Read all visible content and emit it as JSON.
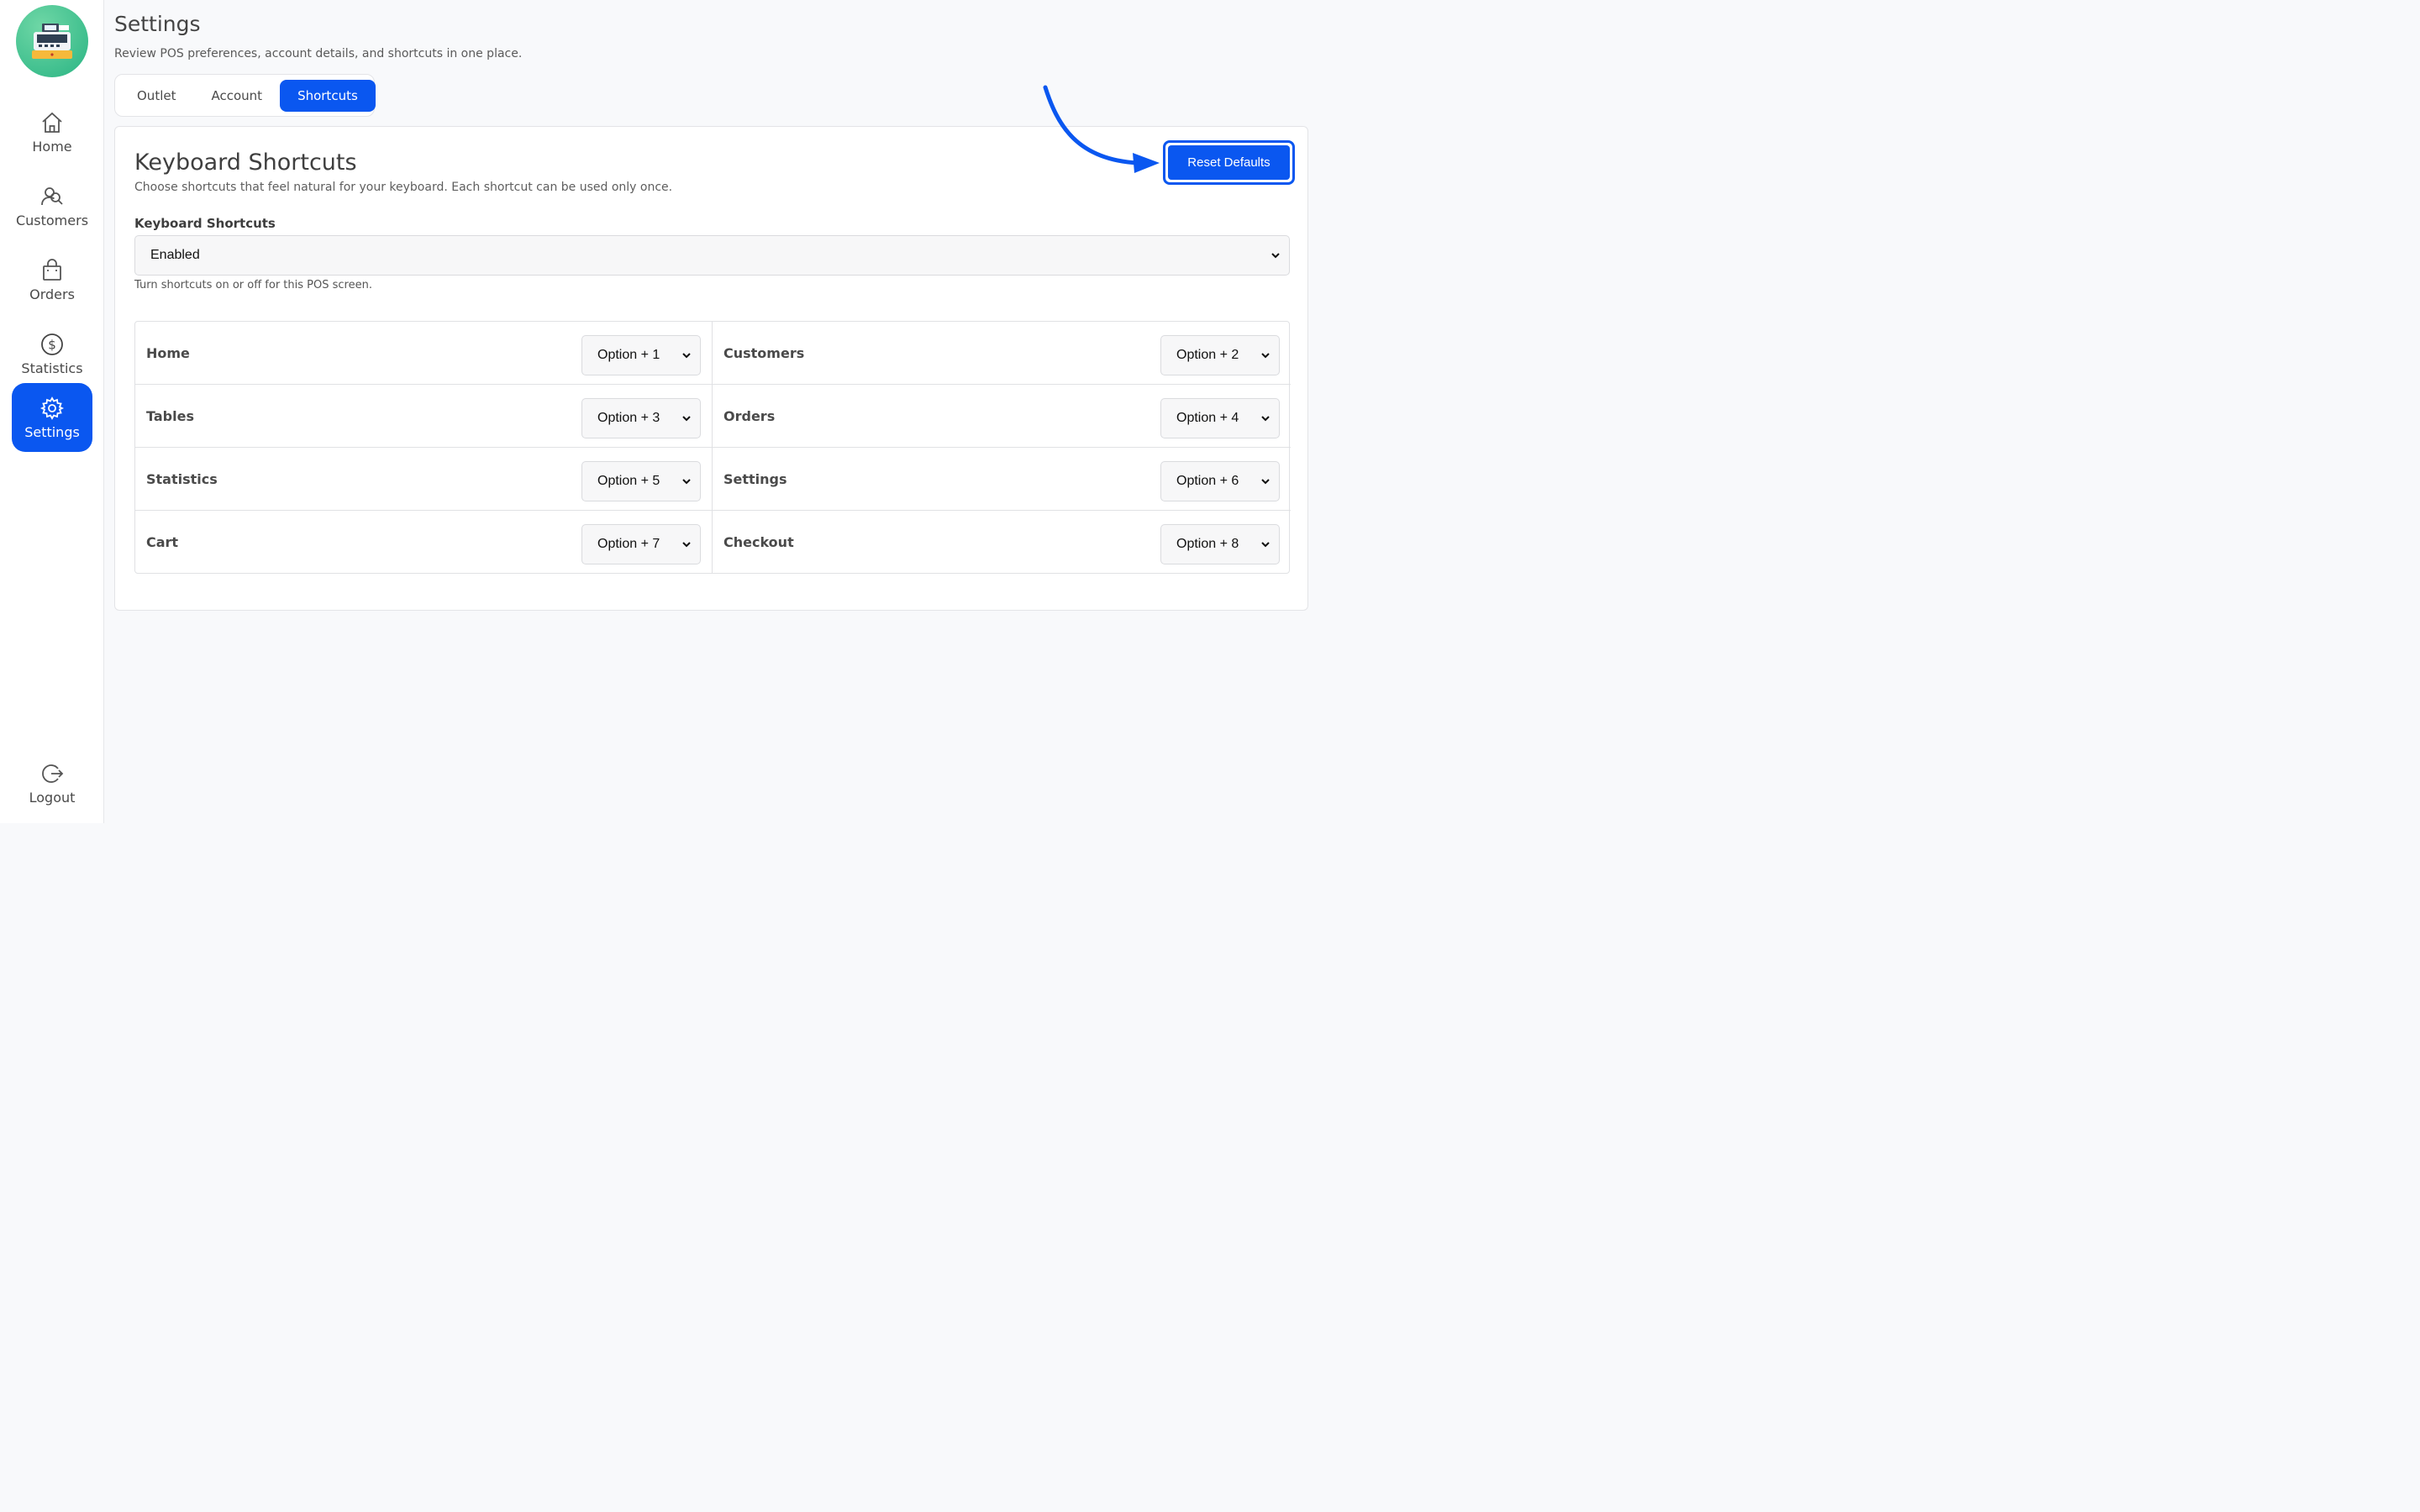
{
  "sidebar": {
    "items": [
      {
        "label": "Home",
        "icon": "home-icon"
      },
      {
        "label": "Customers",
        "icon": "customers-icon"
      },
      {
        "label": "Orders",
        "icon": "bag-icon"
      },
      {
        "label": "Statistics",
        "icon": "dollar-icon"
      },
      {
        "label": "Settings",
        "icon": "gear-icon",
        "active": true
      }
    ],
    "logout_label": "Logout"
  },
  "header": {
    "title": "Settings",
    "subtitle": "Review POS preferences, account details, and shortcuts in one place."
  },
  "tabs": [
    {
      "label": "Outlet"
    },
    {
      "label": "Account"
    },
    {
      "label": "Shortcuts",
      "active": true
    }
  ],
  "card": {
    "title": "Keyboard Shortcuts",
    "subtitle": "Choose shortcuts that feel natural for your keyboard. Each shortcut can be used only once.",
    "reset_label": "Reset Defaults",
    "field_label": "Keyboard Shortcuts",
    "field_value": "Enabled",
    "field_help": "Turn shortcuts on or off for this POS screen."
  },
  "shortcuts": [
    {
      "name": "Home",
      "value": "Option + 1"
    },
    {
      "name": "Customers",
      "value": "Option + 2"
    },
    {
      "name": "Tables",
      "value": "Option + 3"
    },
    {
      "name": "Orders",
      "value": "Option + 4"
    },
    {
      "name": "Statistics",
      "value": "Option + 5"
    },
    {
      "name": "Settings",
      "value": "Option + 6"
    },
    {
      "name": "Cart",
      "value": "Option + 7"
    },
    {
      "name": "Checkout",
      "value": "Option + 8"
    }
  ],
  "colors": {
    "accent": "#0a57f0",
    "logo": "#29b483"
  }
}
